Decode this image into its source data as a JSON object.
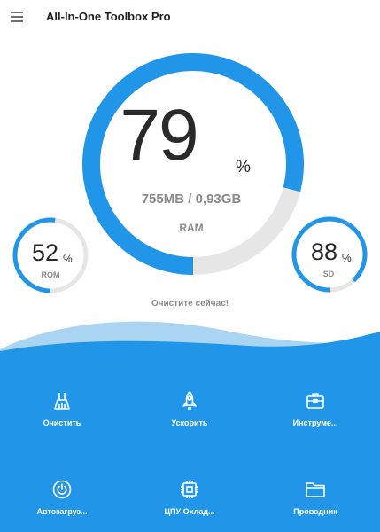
{
  "header": {
    "title": "All-In-One Toolbox Pro",
    "menu_icon": "hamburger-menu-icon"
  },
  "colors": {
    "accent": "#2196E8",
    "track": "#E6E6E6",
    "wave_light": "#A9D4F2"
  },
  "ram": {
    "percent_value": "79",
    "percent_sign": "%",
    "usage": "755MB / 0,93GB",
    "label": "RAM",
    "fraction": 0.79
  },
  "rom": {
    "percent_value": "52",
    "percent_sign": "%",
    "label": "ROM",
    "fraction": 0.52
  },
  "sd": {
    "percent_value": "88",
    "percent_sign": "%",
    "label": "SD",
    "fraction": 0.88
  },
  "clean_now": "Очистите сейчас!",
  "tools": [
    {
      "label": "Очистить",
      "icon": "broom-icon"
    },
    {
      "label": "Ускорить",
      "icon": "rocket-icon"
    },
    {
      "label": "Инструме...",
      "icon": "toolbox-icon"
    },
    {
      "label": "Автозагруз...",
      "icon": "power-icon"
    },
    {
      "label": "ЦПУ Охлад...",
      "icon": "cpu-icon"
    },
    {
      "label": "Проводник",
      "icon": "folder-icon"
    }
  ]
}
